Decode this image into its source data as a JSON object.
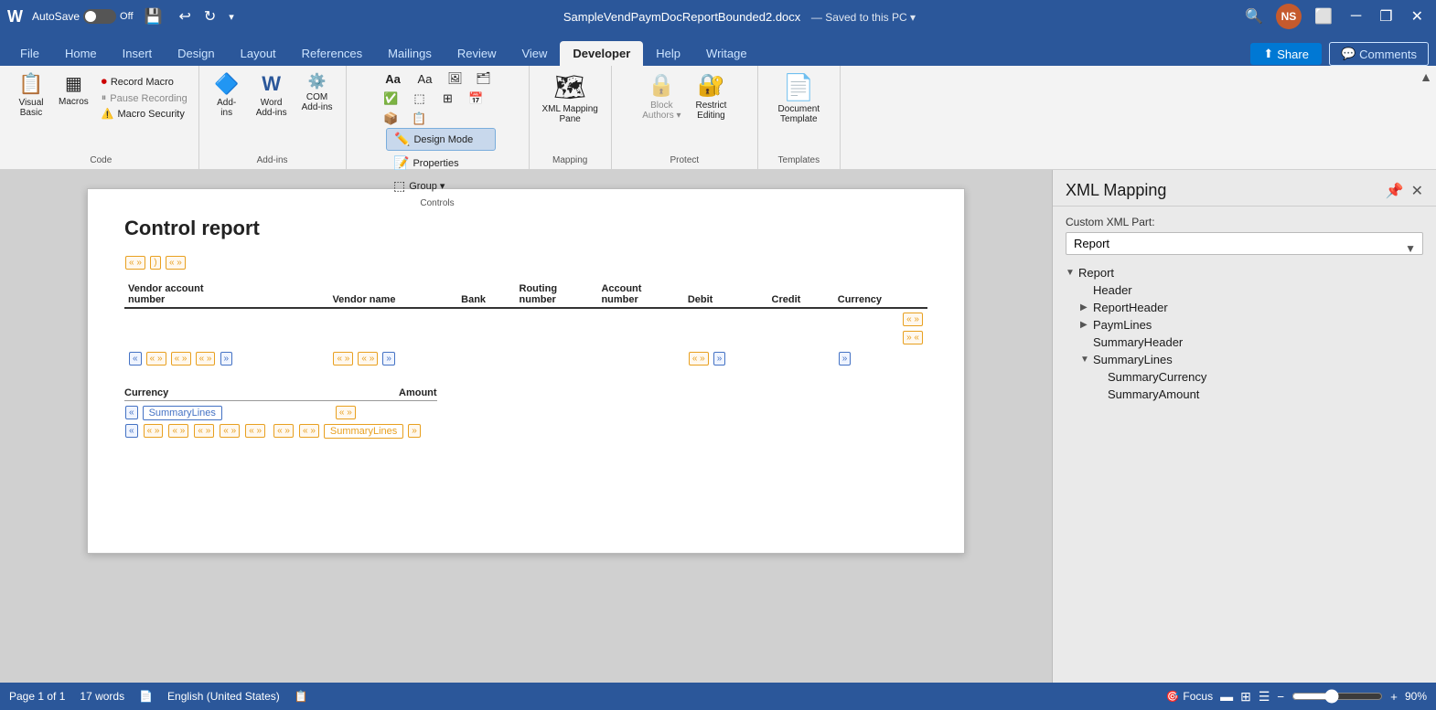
{
  "titlebar": {
    "autosave_label": "AutoSave",
    "autosave_state": "Off",
    "filename": "SampleVendPaymDocReportBounded2.docx",
    "saved_state": "Saved to this PC",
    "search_placeholder": "Search",
    "avatar_initials": "NS",
    "minimize": "─",
    "restore": "❐",
    "close": "✕"
  },
  "tabs": [
    {
      "label": "File"
    },
    {
      "label": "Home"
    },
    {
      "label": "Insert"
    },
    {
      "label": "Design"
    },
    {
      "label": "Layout"
    },
    {
      "label": "References"
    },
    {
      "label": "Mailings"
    },
    {
      "label": "Review"
    },
    {
      "label": "View"
    },
    {
      "label": "Developer",
      "active": true
    },
    {
      "label": "Help"
    },
    {
      "label": "Writage"
    }
  ],
  "share_label": "Share",
  "comments_label": "Comments",
  "ribbon": {
    "groups": [
      {
        "name": "Code",
        "label": "Code",
        "buttons": [
          {
            "label": "Visual\nBasic",
            "icon": "📋"
          },
          {
            "label": "Macros",
            "icon": "📄"
          },
          {
            "label": "Record Macro",
            "icon": "⏺"
          },
          {
            "label": "Pause Recording",
            "icon": "⏸"
          },
          {
            "label": "Macro Security",
            "icon": "⚠️"
          }
        ]
      },
      {
        "name": "Add-ins",
        "label": "Add-ins",
        "buttons": [
          {
            "label": "Add-\nins",
            "icon": "🔷"
          },
          {
            "label": "Word\nAdd-ins",
            "icon": "W"
          },
          {
            "label": "COM\nAdd-ins",
            "icon": "🔧"
          }
        ]
      },
      {
        "name": "Controls",
        "label": "Controls",
        "buttons": [
          {
            "label": "Aa",
            "icon": ""
          },
          {
            "label": "Aa",
            "icon": ""
          },
          {
            "label": "🖼",
            "icon": ""
          },
          {
            "label": "📋",
            "icon": ""
          },
          {
            "label": "✅",
            "icon": ""
          },
          {
            "label": "⊞",
            "icon": ""
          },
          {
            "label": "⊠",
            "icon": ""
          },
          {
            "label": "🔲",
            "icon": ""
          },
          {
            "label": "Design\nMode",
            "icon": "✏️",
            "highlighted": true
          },
          {
            "label": "Properties",
            "icon": "📝"
          },
          {
            "label": "Group",
            "icon": "⬚"
          }
        ]
      },
      {
        "name": "Mapping",
        "label": "Mapping",
        "buttons": [
          {
            "label": "XML Mapping\nPane",
            "icon": "🗺"
          }
        ]
      },
      {
        "name": "Protect",
        "label": "Protect",
        "buttons": [
          {
            "label": "Block\nAuthors",
            "icon": "🔒"
          },
          {
            "label": "Restrict\nEditing",
            "icon": "🔒"
          }
        ]
      },
      {
        "name": "Templates",
        "label": "Templates",
        "buttons": [
          {
            "label": "Document\nTemplate",
            "icon": "W"
          }
        ]
      }
    ]
  },
  "document": {
    "title": "Control report",
    "table": {
      "columns": [
        "Vendor account\nnumber",
        "Vendor name",
        "Bank",
        "Routing\nnumber",
        "Account\nnumber",
        "Debit",
        "Credit",
        "Currency"
      ],
      "rows": []
    },
    "currency_section": {
      "col1": "Currency",
      "col2": "Amount"
    }
  },
  "xml_panel": {
    "title": "XML Mapping",
    "custom_xml_part_label": "Custom XML Part:",
    "selected_part": "Report",
    "tree": [
      {
        "label": "Report",
        "level": 0,
        "expanded": true,
        "arrow": "▼"
      },
      {
        "label": "Header",
        "level": 1,
        "expanded": false,
        "arrow": ""
      },
      {
        "label": "ReportHeader",
        "level": 1,
        "expanded": false,
        "arrow": "▶"
      },
      {
        "label": "PaymLines",
        "level": 1,
        "expanded": false,
        "arrow": "▶"
      },
      {
        "label": "SummaryHeader",
        "level": 1,
        "expanded": false,
        "arrow": ""
      },
      {
        "label": "SummaryLines",
        "level": 1,
        "expanded": true,
        "arrow": "▼"
      },
      {
        "label": "SummaryCurrency",
        "level": 2,
        "expanded": false,
        "arrow": ""
      },
      {
        "label": "SummaryAmount",
        "level": 2,
        "expanded": false,
        "arrow": ""
      }
    ]
  },
  "statusbar": {
    "page_info": "Page 1 of 1",
    "word_count": "17 words",
    "language": "English (United States)",
    "focus_label": "Focus",
    "zoom_percent": "90%"
  }
}
